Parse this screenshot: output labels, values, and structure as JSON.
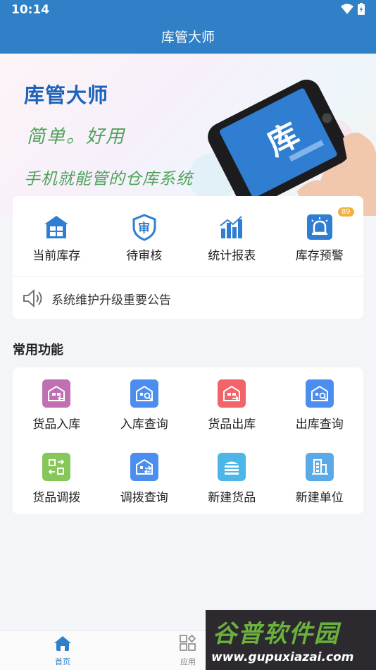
{
  "status_bar": {
    "time": "10:14"
  },
  "app_title": "库管大师",
  "banner": {
    "title": "库管大师",
    "slogan1": "简单。好用",
    "slogan2": "手机就能管的仓库系统",
    "phone_logo": "库"
  },
  "quick": {
    "items": [
      {
        "label": "当前库存",
        "icon": "warehouse-icon"
      },
      {
        "label": "待审核",
        "icon": "audit-shield-icon"
      },
      {
        "label": "统计报表",
        "icon": "bar-chart-icon"
      },
      {
        "label": "库存预警",
        "icon": "alarm-icon",
        "badge": "89"
      }
    ],
    "notice": {
      "text": "系统维护升级重要公告",
      "icon": "speaker-icon"
    }
  },
  "common": {
    "title": "常用功能",
    "items": [
      {
        "label": "货品入库",
        "icon": "goods-inbound-icon",
        "color": "#c06fb3"
      },
      {
        "label": "入库查询",
        "icon": "inbound-query-icon",
        "color": "#4c8ef0"
      },
      {
        "label": "货品出库",
        "icon": "goods-outbound-icon",
        "color": "#f1646a"
      },
      {
        "label": "出库查询",
        "icon": "outbound-query-icon",
        "color": "#4c8ef0"
      },
      {
        "label": "货品调拨",
        "icon": "transfer-icon",
        "color": "#86c75a"
      },
      {
        "label": "调拨查询",
        "icon": "transfer-query-icon",
        "color": "#4c8ef0"
      },
      {
        "label": "新建货品",
        "icon": "new-goods-icon",
        "color": "#4cb6e8"
      },
      {
        "label": "新建单位",
        "icon": "new-unit-icon",
        "color": "#5aaae8"
      }
    ]
  },
  "nav": {
    "home": "首页",
    "apps": "应用"
  },
  "watermark": {
    "title": "谷普软件园",
    "url": "www.gupuxiazai.com"
  },
  "colors": {
    "primary": "#2f80c7",
    "accent_green": "#4fa35a",
    "badge": "#f3b13c"
  }
}
